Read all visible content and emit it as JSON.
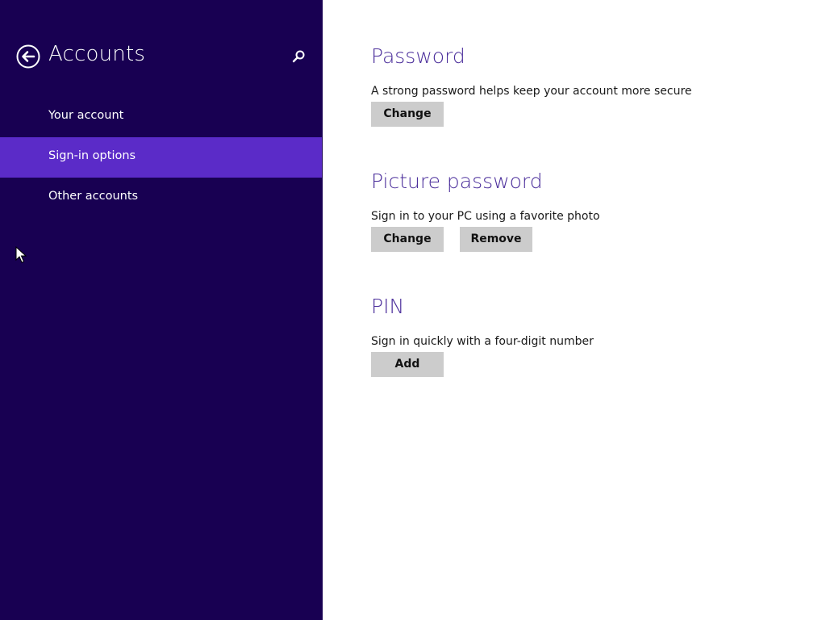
{
  "colors": {
    "nav_background": "#180052",
    "nav_selected": "#5b2bc8",
    "accent_heading": "#4b2e9b",
    "button_background": "#cccccc"
  },
  "nav": {
    "back_icon": "circle-arrow-left-icon",
    "title": "Accounts",
    "search_icon": "search-icon",
    "items": [
      {
        "label": "Your account",
        "selected": false
      },
      {
        "label": "Sign-in options",
        "selected": true
      },
      {
        "label": "Other accounts",
        "selected": false
      }
    ]
  },
  "sections": {
    "password": {
      "title": "Password",
      "description": "A strong password helps keep your account more secure",
      "change_label": "Change"
    },
    "picture_password": {
      "title": "Picture password",
      "description": "Sign in to your PC using a favorite photo",
      "change_label": "Change",
      "remove_label": "Remove"
    },
    "pin": {
      "title": "PIN",
      "description": "Sign in quickly with a four-digit number",
      "add_label": "Add"
    }
  }
}
